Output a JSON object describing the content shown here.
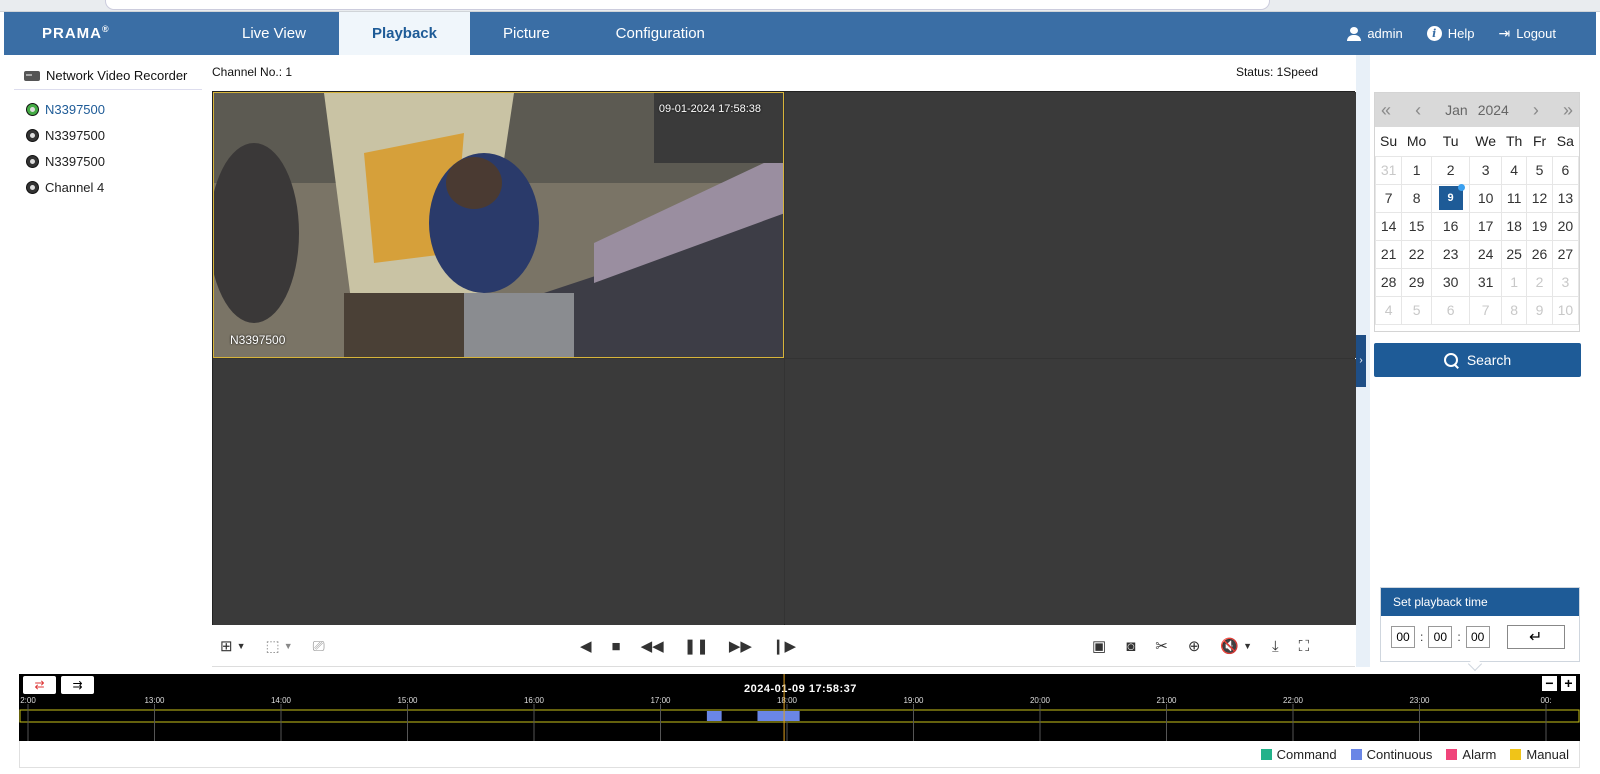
{
  "brand": "PRAMA",
  "nav": {
    "tabs": [
      "Live View",
      "Playback",
      "Picture",
      "Configuration"
    ],
    "active_tab": "Playback"
  },
  "user": {
    "name": "admin",
    "help": "Help",
    "logout": "Logout"
  },
  "sidebar": {
    "title": "Network Video Recorder",
    "cameras": [
      {
        "label": "N3397500",
        "active": true
      },
      {
        "label": "N3397500",
        "active": false
      },
      {
        "label": "N3397500",
        "active": false
      },
      {
        "label": "Channel 4",
        "active": false
      }
    ]
  },
  "video": {
    "channel_label": "Channel No.: 1",
    "status": "Status: 1Speed",
    "osd_time": "09-01-2024 17:58:38",
    "osd_name": "N3397500"
  },
  "calendar": {
    "month": "Jan",
    "year": "2024",
    "weekdays": [
      "Su",
      "Mo",
      "Tu",
      "We",
      "Th",
      "Fr",
      "Sa"
    ],
    "weeks": [
      [
        "31",
        "1",
        "2",
        "3",
        "4",
        "5",
        "6"
      ],
      [
        "7",
        "8",
        "9",
        "10",
        "11",
        "12",
        "13"
      ],
      [
        "14",
        "15",
        "16",
        "17",
        "18",
        "19",
        "20"
      ],
      [
        "21",
        "22",
        "23",
        "24",
        "25",
        "26",
        "27"
      ],
      [
        "28",
        "29",
        "30",
        "31",
        "1",
        "2",
        "3"
      ],
      [
        "4",
        "5",
        "6",
        "7",
        "8",
        "9",
        "10"
      ]
    ],
    "selected_day": "9"
  },
  "search_label": "Search",
  "playback_time": {
    "title": "Set playback time",
    "hh": "00",
    "mm": "00",
    "ss": "00",
    "enter_glyph": "↵"
  },
  "timeline": {
    "current_time": "2024-01-09 17:58:37",
    "ticks": [
      "2:00",
      "13:00",
      "14:00",
      "15:00",
      "16:00",
      "17:00",
      "18:00",
      "19:00",
      "20:00",
      "21:00",
      "22:00",
      "23:00",
      "00:"
    ],
    "recordings": [
      {
        "type": "Continuous",
        "start": "17:22",
        "end": "17:29"
      },
      {
        "type": "Continuous",
        "start": "17:46",
        "end": "18:06"
      }
    ]
  },
  "legend": [
    {
      "label": "Command",
      "color": "#22b28a"
    },
    {
      "label": "Continuous",
      "color": "#6a86e6"
    },
    {
      "label": "Alarm",
      "color": "#f0447a"
    },
    {
      "label": "Manual",
      "color": "#f0c418"
    }
  ],
  "colors": {
    "nav_bar": "#3a6ea5",
    "accent": "#1e5b97",
    "timeline_frame": "#c8c21a",
    "playhead": "#e0a020"
  }
}
